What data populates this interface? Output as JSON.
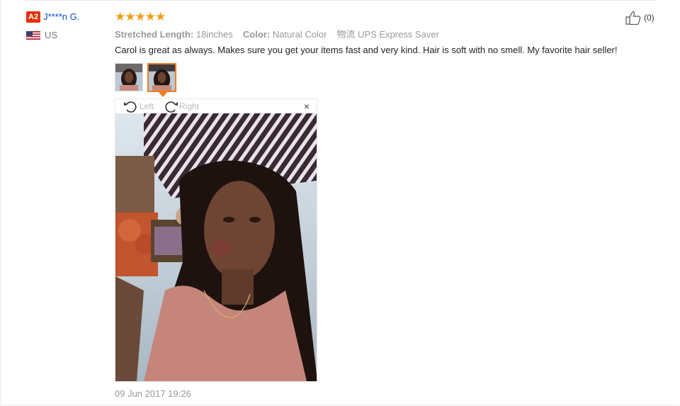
{
  "user": {
    "level": "A2",
    "name": "J****n G.",
    "country": "US"
  },
  "review": {
    "rating_stars": "★★★★★",
    "rating": 5,
    "attributes": [
      {
        "label": "Stretched Length:",
        "value": "18inches"
      },
      {
        "label": "Color:",
        "value": "Natural Color"
      }
    ],
    "shipping": "物流 UPS Express Saver",
    "text": "Carol is great as always. Makes sure you get your items fast and very kind. Hair is soft with no smell. My favorite hair seller!",
    "date": "09 Jun 2017 19:26",
    "helpful_count": "(0)"
  },
  "viewer": {
    "rotate_left": "Left",
    "rotate_right": "Right",
    "close": "×"
  },
  "icons": [
    "thumbs-up-icon",
    "rotate-left-icon",
    "rotate-right-icon",
    "close-icon",
    "us-flag-icon"
  ],
  "colors": {
    "level_badge": "#e62e04",
    "username": "#0051c4",
    "stars": "#f39c12",
    "active_thumb": "#f07b1e"
  }
}
